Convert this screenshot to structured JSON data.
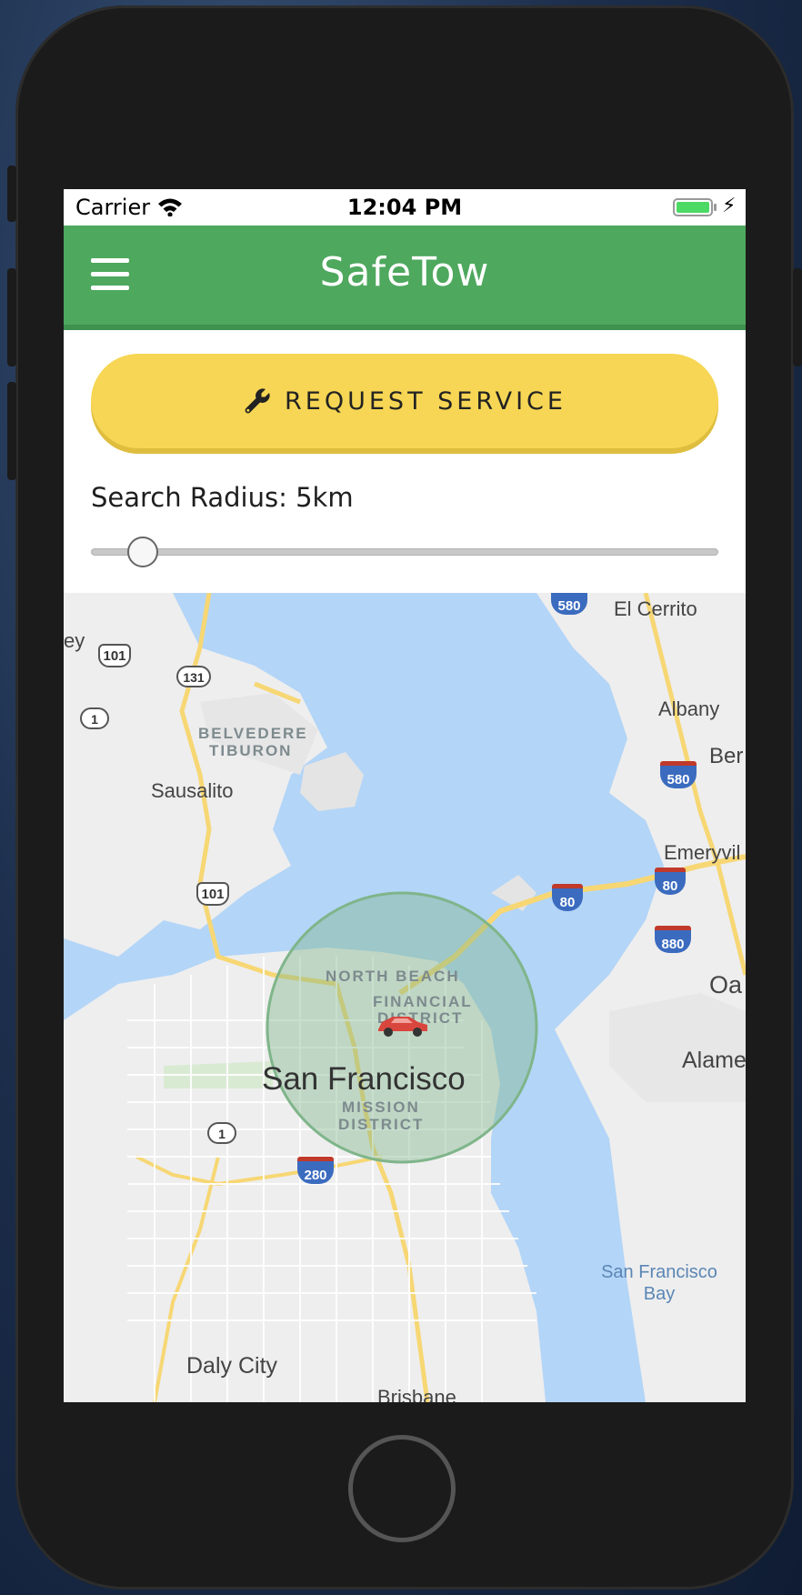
{
  "status_bar": {
    "carrier": "Carrier",
    "time": "12:04 PM"
  },
  "header": {
    "title": "SafeTow"
  },
  "request_button": {
    "label": "REQUEST SERVICE"
  },
  "search": {
    "radius_label": "Search Radius: 5km",
    "radius_km": 5
  },
  "map": {
    "labels": {
      "el_cerrito": "El Cerrito",
      "albany": "Albany",
      "berkeley": "Ber",
      "emeryville": "Emeryvil",
      "oakland": "Oa",
      "alameda": "Alame",
      "sausalito": "Sausalito",
      "ey": "ey",
      "san_francisco": "San Francisco",
      "daly_city": "Daly City",
      "brisbane": "Brisbane",
      "sf_bay": "San Francisco Bay"
    },
    "districts": {
      "belvedere": "BELVEDERE",
      "tiburon": "TIBURON",
      "north_beach": "NORTH BEACH",
      "financial": "FINANCIAL",
      "district": "DISTRICT",
      "mission": "MISSION",
      "mission_district": "DISTRICT"
    },
    "shields": {
      "us101_a": "101",
      "us101_b": "101",
      "ca131": "131",
      "ca1_a": "1",
      "ca1_b": "1",
      "i580_a": "580",
      "i580_b": "580",
      "i80_a": "80",
      "i80_b": "80",
      "i880": "880",
      "i280": "280"
    },
    "colors": {
      "water": "#b3d5f7",
      "land": "#eeeeee",
      "road": "#f7d774",
      "radius_circle": "#7fb58a",
      "vehicle": "#d9463e"
    }
  },
  "colors": {
    "header": "#4ea85e",
    "button": "#f6d654"
  },
  "icons": [
    "menu-icon",
    "wrench-icon",
    "wifi-icon",
    "battery-icon",
    "car-icon"
  ]
}
